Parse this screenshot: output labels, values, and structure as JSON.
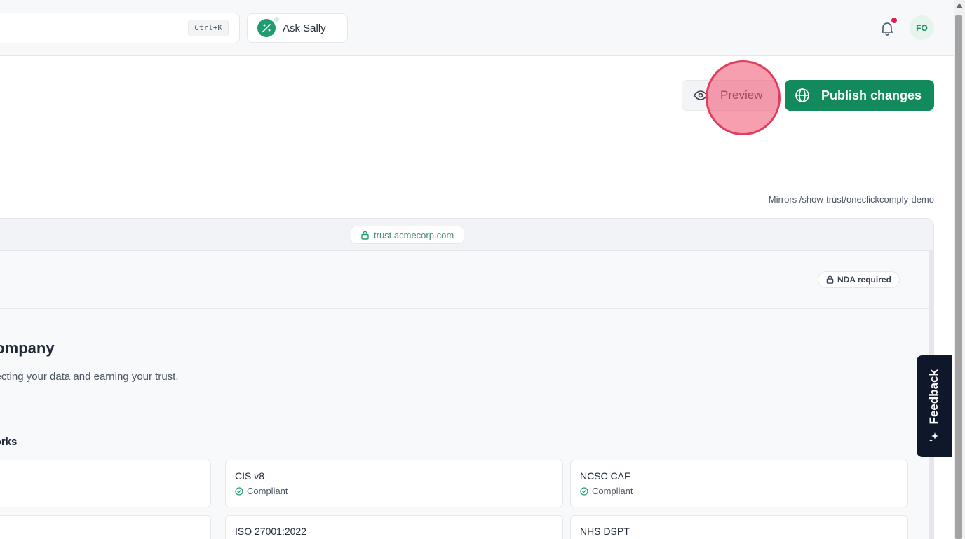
{
  "topbar": {
    "search_shortcut": "Ctrl+K",
    "ask_label": "Ask Sally",
    "avatar_initials": "FO"
  },
  "actions": {
    "preview_label": "Preview",
    "publish_label": "Publish changes"
  },
  "mirrors_text": "Mirrors /show-trust/oneclickcomply-demo",
  "preview_frame": {
    "url": "trust.acmecorp.com",
    "nda_label": "NDA required",
    "hero_title": "company",
    "hero_subtitle": "otecting your data and earning your trust.",
    "section_title": "works",
    "frameworks": [
      {
        "name": "CIS v8",
        "status": "Compliant"
      },
      {
        "name": "NCSC CAF",
        "status": "Compliant"
      },
      {
        "name": "ISO 27001:2022",
        "status": ""
      },
      {
        "name": "NHS DSPT",
        "status": ""
      }
    ]
  },
  "feedback_label": "Feedback",
  "colors": {
    "brand_green": "#128a5b",
    "accent_green": "#1f9d6f",
    "notification_red": "#e11d48",
    "feedback_bg": "#0f172a"
  }
}
